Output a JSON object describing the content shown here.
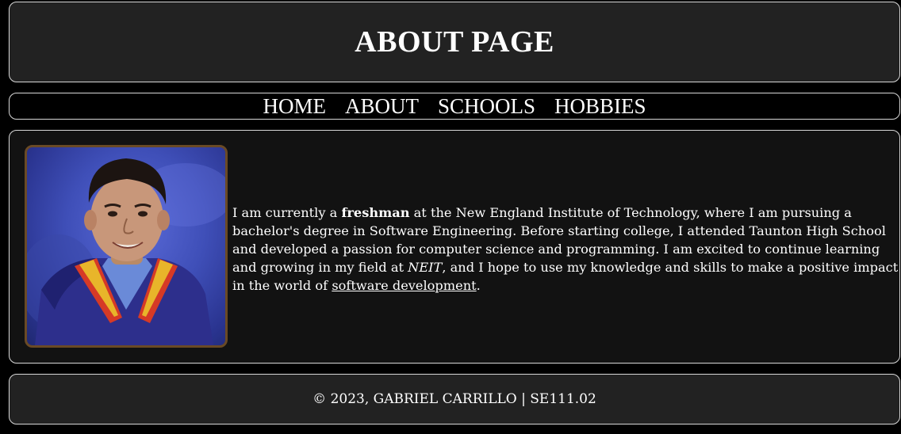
{
  "header": {
    "title": "ABOUT PAGE"
  },
  "nav": {
    "items": [
      {
        "label": "HOME"
      },
      {
        "label": "ABOUT"
      },
      {
        "label": "SCHOOLS"
      },
      {
        "label": "HOBBIES"
      }
    ]
  },
  "main": {
    "bio": {
      "p1": "I am currently a ",
      "bold": "freshman",
      "p2": " at the New England Institute of Technology, where I am pursuing a bachelor's degree in Software Engineering. Before starting college, I attended Taunton High School and developed a passion for computer science and programming. I am excited to continue learning and growing in my field at ",
      "italic": "NEIT",
      "p3": ", and I hope to use my knowledge and skills to make a positive impact in the world of ",
      "link": "software development",
      "p4": "."
    }
  },
  "footer": {
    "text": "© 2023, GABRIEL CARRILLO | SE111.02"
  },
  "colors": {
    "page_background": "#000000",
    "panel_background": "#222222",
    "main_background": "#121212",
    "panel_border": "#d8d8d8",
    "photo_border": "#6a4a25",
    "text": "#ffffff"
  }
}
